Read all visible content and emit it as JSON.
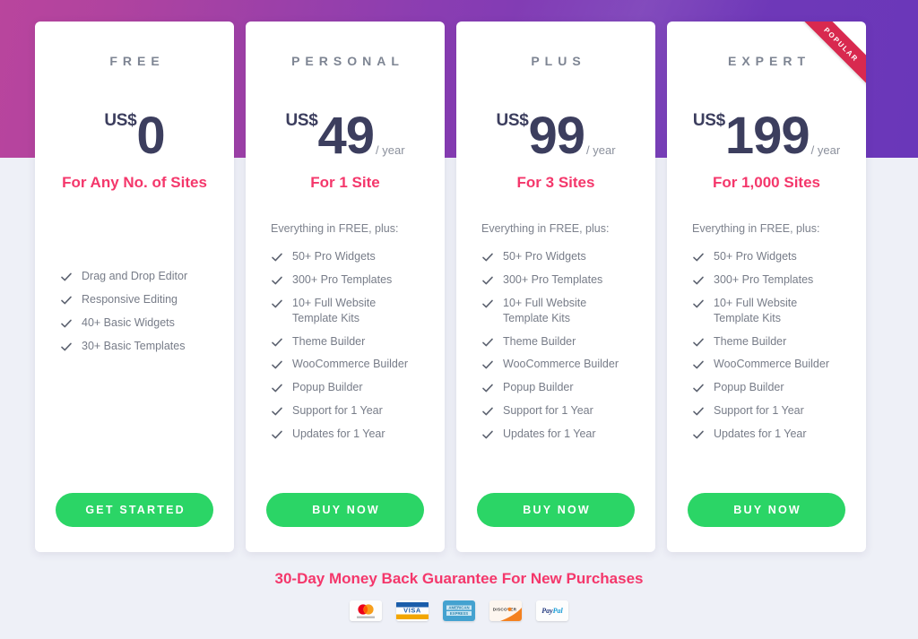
{
  "theme": {
    "gradient_left": "#b9459d",
    "gradient_right": "#6a37b9",
    "page_background": "#eef0f7",
    "accent_pink": "#f4376b",
    "cta_green": "#2bd566",
    "price_navy": "#3c3e5e",
    "ribbon_red": "#d8294f"
  },
  "plans": [
    {
      "name": "FREE",
      "currency": "US$",
      "amount": "0",
      "period": "",
      "sites": "For Any No. of Sites",
      "everything": "",
      "features": [
        "Drag and Drop Editor",
        "Responsive Editing",
        "40+ Basic Widgets",
        "30+ Basic Templates"
      ],
      "cta_label": "GET STARTED",
      "ribbon": ""
    },
    {
      "name": "PERSONAL",
      "currency": "US$",
      "amount": "49",
      "period": "/ year",
      "sites": "For 1 Site",
      "everything": "Everything in FREE, plus:",
      "features": [
        "50+ Pro Widgets",
        "300+ Pro Templates",
        "10+ Full Website\nTemplate Kits",
        "Theme Builder",
        "WooCommerce Builder",
        "Popup Builder",
        "Support for 1 Year",
        "Updates for 1 Year"
      ],
      "cta_label": "BUY NOW",
      "ribbon": ""
    },
    {
      "name": "PLUS",
      "currency": "US$",
      "amount": "99",
      "period": "/ year",
      "sites": "For 3 Sites",
      "everything": "Everything in FREE, plus:",
      "features": [
        "50+ Pro Widgets",
        "300+ Pro Templates",
        "10+ Full Website\nTemplate Kits",
        "Theme Builder",
        "WooCommerce Builder",
        "Popup Builder",
        "Support for 1 Year",
        "Updates for 1 Year"
      ],
      "cta_label": "BUY NOW",
      "ribbon": ""
    },
    {
      "name": "EXPERT",
      "currency": "US$",
      "amount": "199",
      "period": "/ year",
      "sites": "For 1,000 Sites",
      "everything": "Everything in FREE, plus:",
      "features": [
        "50+ Pro Widgets",
        "300+ Pro Templates",
        "10+ Full Website\nTemplate Kits",
        "Theme Builder",
        "WooCommerce Builder",
        "Popup Builder",
        "Support for 1 Year",
        "Updates for 1 Year"
      ],
      "cta_label": "BUY NOW",
      "ribbon": "POPULAR"
    }
  ],
  "footer": {
    "guarantee": "30-Day Money Back Guarantee For New Purchases",
    "payment_icons": [
      "mastercard-icon",
      "visa-icon",
      "american-express-icon",
      "discover-icon",
      "paypal-icon"
    ]
  }
}
